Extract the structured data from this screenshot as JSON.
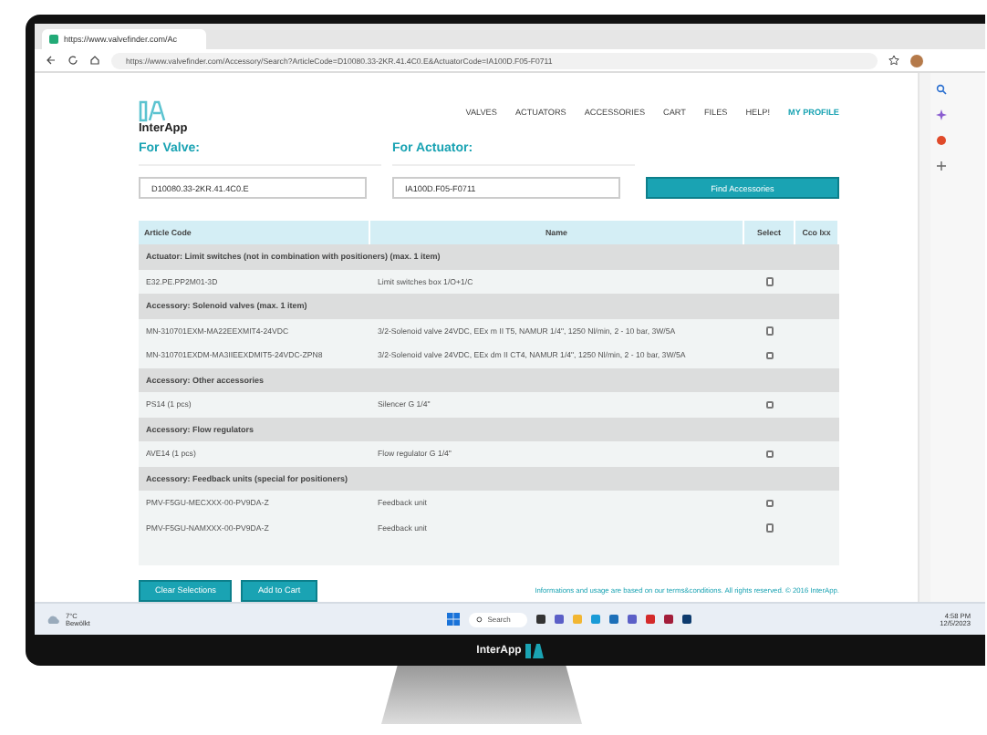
{
  "browser": {
    "tab_title": "https://www.valvefinder.com/Ac",
    "url": "https://www.valvefinder.com/Accessory/Search?ArticleCode=D10080.33-2KR.41.4C0.E&ActuatorCode=IA100D.F05-F0711"
  },
  "site": {
    "logo": "InterApp",
    "nav": [
      {
        "label": "VALVES",
        "selected": false
      },
      {
        "label": "ACTUATORS",
        "selected": false
      },
      {
        "label": "ACCESSORIES",
        "selected": false
      },
      {
        "label": "CART",
        "selected": false
      },
      {
        "label": "FILES",
        "selected": false
      },
      {
        "label": "HELP!",
        "selected": false
      },
      {
        "label": "MY PROFILE",
        "selected": true
      }
    ]
  },
  "search": {
    "valve_label": "For Valve:",
    "valve_value": "D10080.33-2KR.41.4C0.E",
    "actuator_label": "For Actuator:",
    "actuator_value": "IA100D.F05-F0711",
    "button": "Find Accessories"
  },
  "table": {
    "columns": [
      "Article Code",
      "Name",
      "Select",
      "Cco lxx"
    ],
    "rows": [
      {
        "kind": "group",
        "label": "Actuator: Limit switches (not in combination with positioners) (max. 1 item)"
      },
      {
        "kind": "item",
        "code": "E32.PE.PP2M01-3D",
        "name": "Limit switches box 1/O+1/C",
        "checked": false
      },
      {
        "kind": "group",
        "label": "Accessory: Solenoid valves (max. 1 item)"
      },
      {
        "kind": "item",
        "code": "MN-310701EXM-MA22EEXMIT4-24VDC",
        "name": "3/2-Solenoid valve 24VDC, EEx m II T5, NAMUR 1/4\", 1250 Nl/min, 2 - 10 bar, 3W/5A",
        "checked": false
      },
      {
        "kind": "item",
        "code": "MN-310701EXDM-MA3IIEEXDMIT5-24VDC-ZPN8",
        "name": "3/2-Solenoid valve 24VDC, EEx dm II CT4, NAMUR 1/4\", 1250 Nl/min, 2 - 10 bar, 3W/5A",
        "checked": false
      },
      {
        "kind": "group",
        "label": "Accessory: Other accessories"
      },
      {
        "kind": "item",
        "code": "PS14 (1 pcs)",
        "name": "Silencer G 1/4\"",
        "checked": false
      },
      {
        "kind": "group",
        "label": "Accessory: Flow regulators"
      },
      {
        "kind": "item",
        "code": "AVE14 (1 pcs)",
        "name": "Flow regulator G 1/4\"",
        "checked": false
      },
      {
        "kind": "group",
        "label": "Accessory: Feedback units (special for positioners)"
      },
      {
        "kind": "item",
        "code": "PMV-F5GU-MECXXX-00-PV9DA-Z",
        "name": "Feedback unit",
        "checked": false
      },
      {
        "kind": "item",
        "code": "PMV-F5GU-NAMXXX-00-PV9DA-Z",
        "name": "Feedback unit",
        "checked": false
      }
    ]
  },
  "actions": [
    "Clear Selections",
    "Add to Cart"
  ],
  "footer": "Informations and usage are based on our terms&conditions. All rights reserved. © 2016 InterApp.",
  "taskbar": {
    "weather_temp": "7°C",
    "weather_text": "Bewölkt",
    "search": "Search",
    "time": "4:58 PM",
    "date": "12/5/2023"
  },
  "monitor": {
    "brand": "InterApp"
  }
}
